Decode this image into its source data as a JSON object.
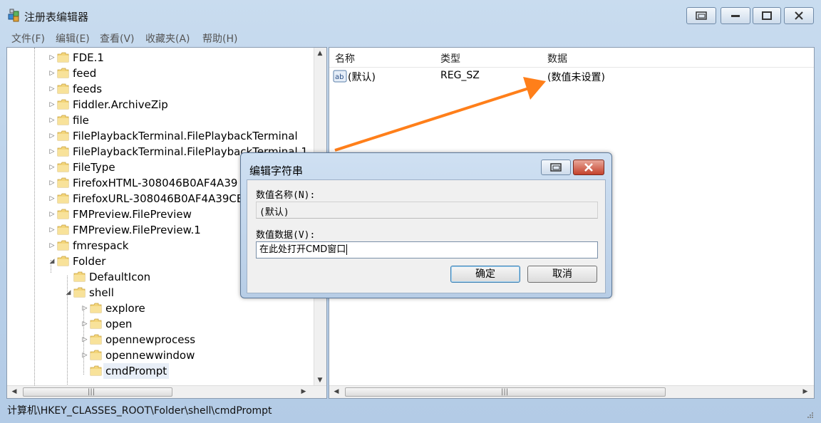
{
  "window": {
    "title": "注册表编辑器",
    "accent_color": "#ff7f1a"
  },
  "menu": [
    "文件(F)",
    "编辑(E)",
    "查看(V)",
    "收藏夹(A)",
    "帮助(H)"
  ],
  "tree": {
    "items": [
      {
        "label": "FDE.1",
        "depth": 1,
        "expander": "collapsed"
      },
      {
        "label": "feed",
        "depth": 1,
        "expander": "collapsed"
      },
      {
        "label": "feeds",
        "depth": 1,
        "expander": "collapsed"
      },
      {
        "label": "Fiddler.ArchiveZip",
        "depth": 1,
        "expander": "collapsed"
      },
      {
        "label": "file",
        "depth": 1,
        "expander": "collapsed"
      },
      {
        "label": "FilePlaybackTerminal.FilePlaybackTerminal",
        "depth": 1,
        "expander": "collapsed"
      },
      {
        "label": "FilePlaybackTerminal.FilePlaybackTerminal.1",
        "depth": 1,
        "expander": "collapsed"
      },
      {
        "label": "FileType",
        "depth": 1,
        "expander": "collapsed"
      },
      {
        "label": "FirefoxHTML-308046B0AF4A39",
        "depth": 1,
        "expander": "collapsed"
      },
      {
        "label": "FirefoxURL-308046B0AF4A39CE",
        "depth": 1,
        "expander": "collapsed"
      },
      {
        "label": "FMPreview.FilePreview",
        "depth": 1,
        "expander": "collapsed"
      },
      {
        "label": "FMPreview.FilePreview.1",
        "depth": 1,
        "expander": "collapsed"
      },
      {
        "label": "fmrespack",
        "depth": 1,
        "expander": "collapsed"
      },
      {
        "label": "Folder",
        "depth": 1,
        "expander": "expanded"
      },
      {
        "label": "DefaultIcon",
        "depth": 2,
        "expander": "none"
      },
      {
        "label": "shell",
        "depth": 2,
        "expander": "expanded"
      },
      {
        "label": "explore",
        "depth": 3,
        "expander": "collapsed"
      },
      {
        "label": "open",
        "depth": 3,
        "expander": "collapsed"
      },
      {
        "label": "opennewprocess",
        "depth": 3,
        "expander": "collapsed"
      },
      {
        "label": "opennewwindow",
        "depth": 3,
        "expander": "collapsed"
      },
      {
        "label": "cmdPrompt",
        "depth": 3,
        "expander": "none",
        "selected": true
      }
    ]
  },
  "list": {
    "headers": {
      "name": "名称",
      "type": "类型",
      "data": "数据"
    },
    "rows": [
      {
        "name": "(默认)",
        "type": "REG_SZ",
        "data": "(数值未设置)",
        "icon": "string-value-icon"
      }
    ]
  },
  "statusbar": {
    "path": "计算机\\HKEY_CLASSES_ROOT\\Folder\\shell\\cmdPrompt"
  },
  "dialog": {
    "title": "编辑字符串",
    "name_label": "数值名称(N):",
    "name_value": "(默认)",
    "data_label": "数值数据(V):",
    "data_value": "在此处打开CMD窗口",
    "ok": "确定",
    "cancel": "取消"
  },
  "icons": {
    "expand_collapsed": "▷",
    "expand_expanded": "◢",
    "scroll_left": "◀",
    "scroll_right": "▶",
    "scroll_up": "▲",
    "scroll_down": "▼",
    "grip": "|||"
  }
}
